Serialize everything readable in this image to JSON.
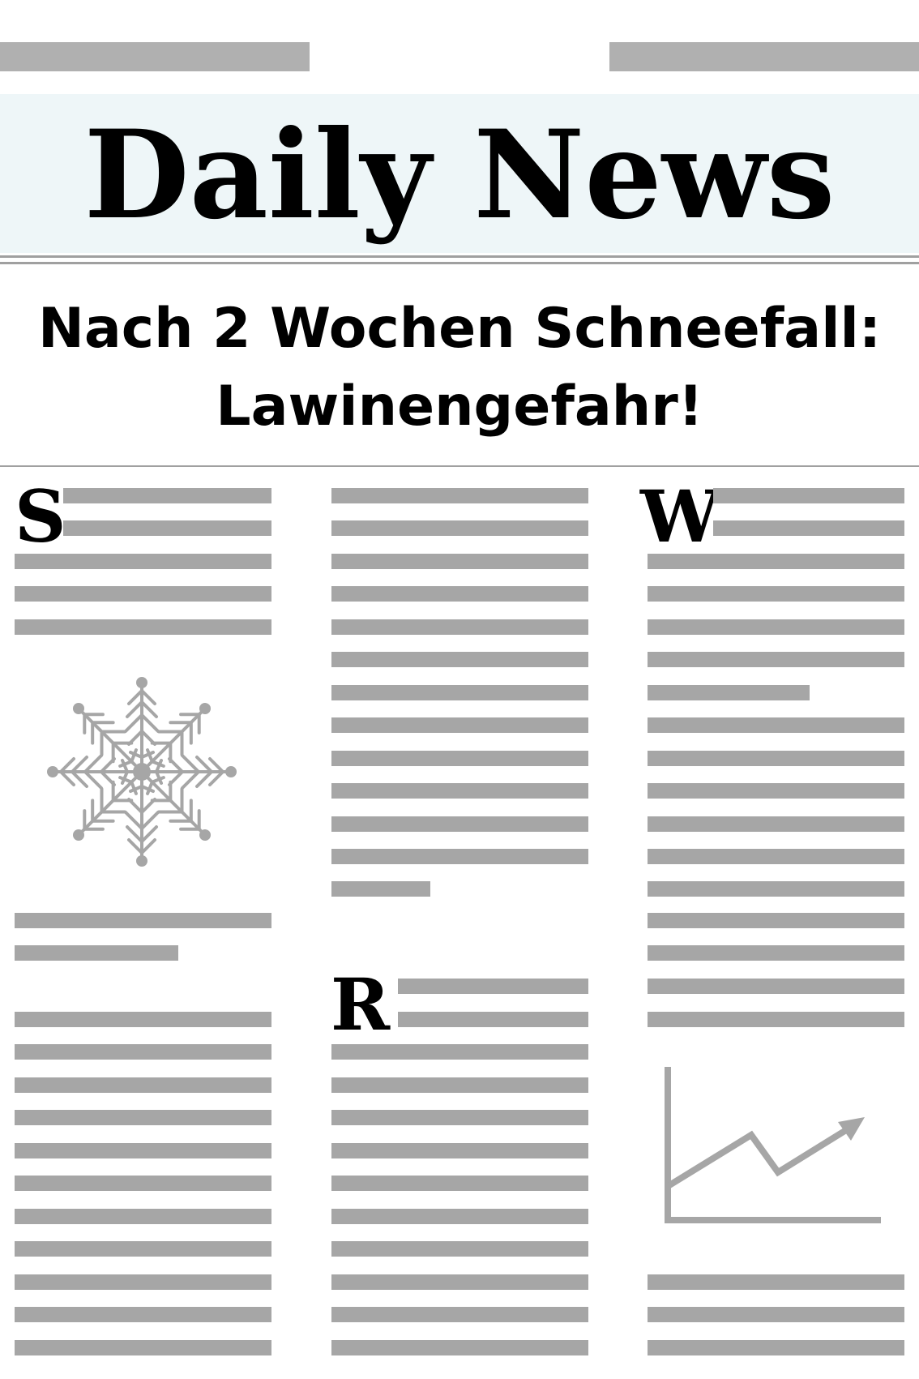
{
  "masthead": {
    "title": "Daily News"
  },
  "headline": {
    "line1": "Nach 2 Wochen Schneefall:",
    "line2": "Lawinengefahr!"
  },
  "columns": [
    {
      "dropcap": "S"
    },
    {
      "dropcap": "R"
    },
    {
      "dropcap": "W"
    }
  ],
  "icons": {
    "left": "snowflake-icon",
    "right": "trend-chart-icon"
  },
  "colors": {
    "text_placeholder": "#a6a6a6",
    "masthead_bg": "#eef6f8",
    "ink": "#000000"
  }
}
